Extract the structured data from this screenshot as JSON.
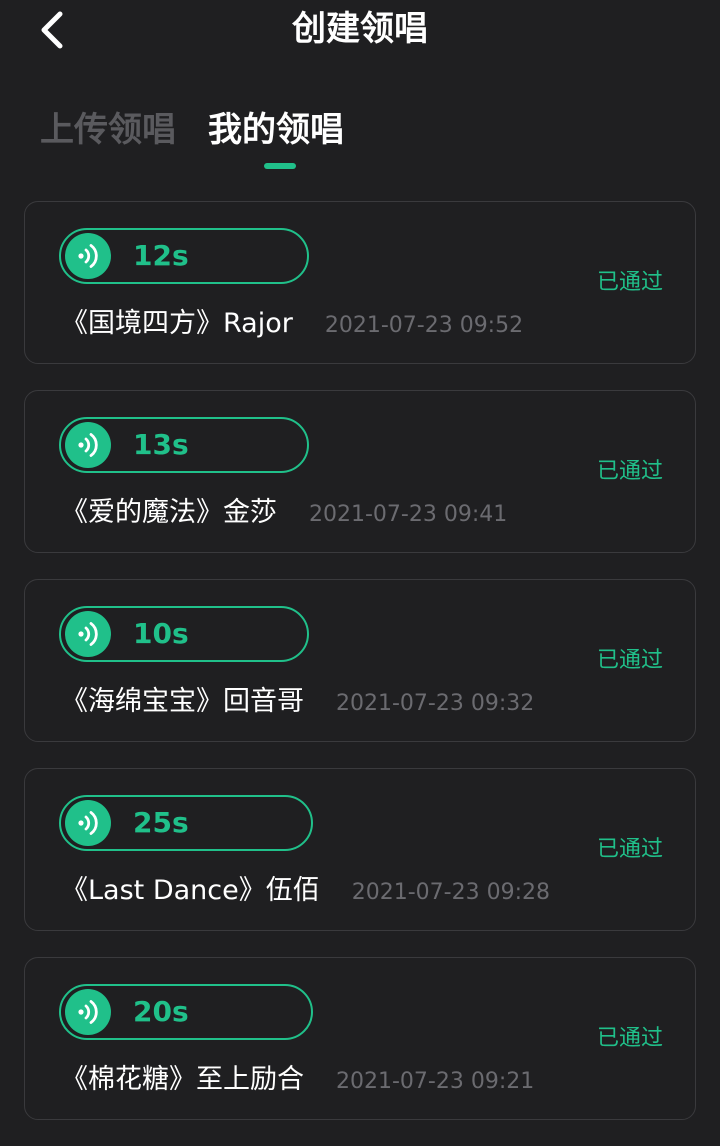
{
  "header": {
    "title": "创建领唱"
  },
  "tabs": [
    {
      "label": "上传领唱",
      "active": false
    },
    {
      "label": "我的领唱",
      "active": true
    }
  ],
  "items": [
    {
      "duration": "12s",
      "song": "《国境四方》Rajor",
      "time": "2021-07-23 09:52",
      "status": "已通过"
    },
    {
      "duration": "13s",
      "song": "《爱的魔法》金莎",
      "time": "2021-07-23 09:41",
      "status": "已通过"
    },
    {
      "duration": "10s",
      "song": "《海绵宝宝》回音哥",
      "time": "2021-07-23 09:32",
      "status": "已通过"
    },
    {
      "duration": "25s",
      "song": "《Last Dance》伍佰",
      "time": "2021-07-23 09:28",
      "status": "已通过"
    },
    {
      "duration": "20s",
      "song": "《棉花糖》至上励合",
      "time": "2021-07-23 09:21",
      "status": "已通过"
    }
  ],
  "colors": {
    "accent": "#20c08a",
    "background": "#1f1f21",
    "card_border": "#3a3a3d",
    "muted_text": "#6b6b70"
  }
}
